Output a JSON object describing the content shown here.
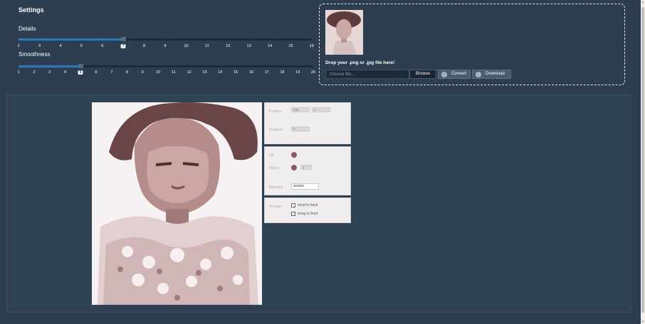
{
  "settings": {
    "title": "Settings",
    "details": {
      "label": "Details",
      "value": 7,
      "min": 2,
      "max": 16,
      "ticks": [
        "2",
        "3",
        "4",
        "5",
        "6",
        "7",
        "8",
        "9",
        "10",
        "11",
        "12",
        "13",
        "14",
        "15",
        "16"
      ]
    },
    "smoothness": {
      "label": "Smoothness",
      "value": 5,
      "min": 1,
      "max": 20,
      "ticks": [
        "1",
        "2",
        "3",
        "4",
        "5",
        "6",
        "7",
        "8",
        "9",
        "10",
        "11",
        "12",
        "13",
        "14",
        "15",
        "16",
        "17",
        "18",
        "19",
        "20"
      ]
    }
  },
  "upload": {
    "drop_text": "Drop your .png or .jpg file here!",
    "file_placeholder": "Choose file...",
    "browse_label": "Browse",
    "convert_label": "Convert",
    "download_label": "Download",
    "convert_icon": "check-icon",
    "download_icon": "download-icon"
  },
  "properties": {
    "position_label": "Position",
    "position_x": "346",
    "position_y": "1",
    "rotation_label": "Rotation",
    "rotation_value": "0",
    "fill_label": "Fill",
    "fill_color": "#8b5a5e",
    "stroke_label": "Stroke",
    "stroke_color": "#8b5a5e",
    "stroke_width": "1",
    "blending_label": "Blending",
    "blending_value": "screen",
    "arrange_label": "Arrange",
    "send_to_back": "send to back",
    "bring_to_front": "bring to front"
  },
  "colors": {
    "background": "#2c3e50",
    "slider_fill": "#2a7ab8",
    "portrait_tone": "#8b5a5e"
  }
}
